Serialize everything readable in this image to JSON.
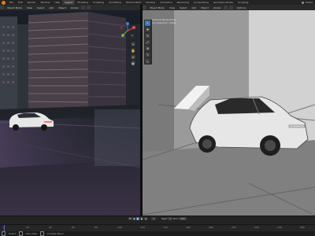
{
  "topbar": {
    "tabs": [
      "File",
      "Edit",
      "Render",
      "Window",
      "Help",
      "Layout",
      "Modeling",
      "Sculpting",
      "UV Editing",
      "Texture Paint",
      "Shading",
      "Animation",
      "Rendering",
      "Compositing",
      "Geometry Nodes",
      "Scripting"
    ],
    "active_tab": "Layout",
    "scene_label": "Scene"
  },
  "left_header": {
    "mode": "Object Mode",
    "menus": [
      "View",
      "Select",
      "Add",
      "Object"
    ],
    "transform": "Global"
  },
  "right_header": {
    "mode": "Object Mode",
    "menus": [
      "View",
      "Select",
      "Add",
      "Object"
    ],
    "transform": "Global",
    "options_label": "Options"
  },
  "right_viewport": {
    "overlay_line1": "Camera Perspective",
    "overlay_line2": "(1) Collection | Mesh"
  },
  "timeline": {
    "frame_current": "1",
    "start_label": "Start",
    "start_value": "1",
    "end_label": "End",
    "end_value": "250",
    "ruler_ticks": [
      "0",
      "20",
      "40",
      "60",
      "80",
      "100",
      "120",
      "140",
      "160",
      "180",
      "200",
      "220",
      "240",
      "260"
    ]
  },
  "status": {
    "items": [
      "Select",
      "Pan View",
      "Context Menu"
    ]
  },
  "colors": {
    "accent": "#4772b3",
    "blender_orange": "#e87d0d",
    "car_body": "#e4e4e4",
    "car_light": "#ff6b6b"
  },
  "icons": [
    "blender-logo-icon",
    "cursor-icon",
    "move-icon",
    "rotate-icon",
    "scale-icon",
    "transform-icon",
    "annotate-icon",
    "measure-icon",
    "camera-icon",
    "grid-icon",
    "hand-icon",
    "zoom-icon"
  ]
}
